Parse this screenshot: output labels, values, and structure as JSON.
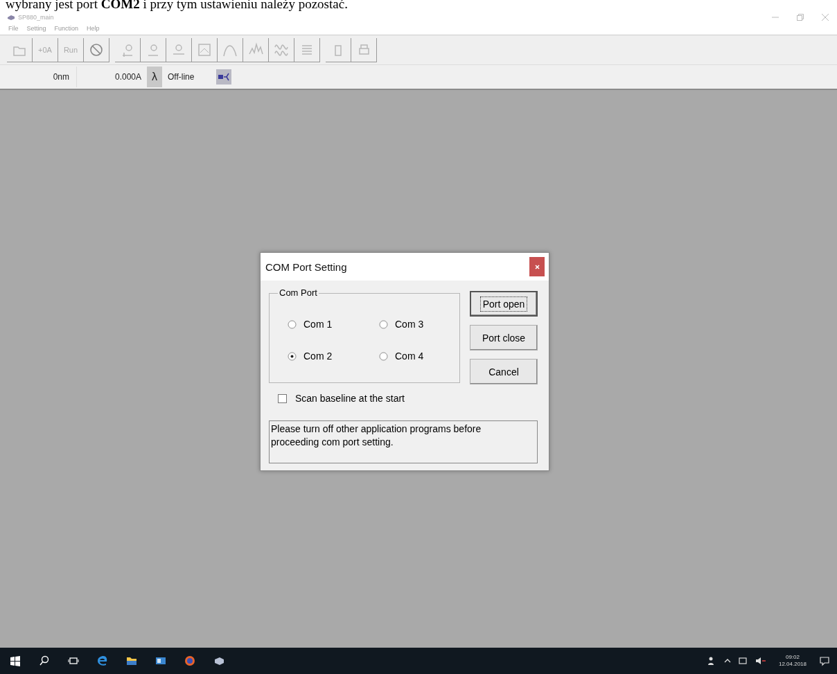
{
  "caption": "wybrany jest port **COM2** i przy tym ustawieniu należy pozostać.",
  "window": {
    "title": "SP880_main"
  },
  "menu": [
    "File",
    "Setting",
    "Function",
    "Help"
  ],
  "toolbar": [
    {
      "kind": "icon"
    },
    {
      "kind": "text",
      "label": "+0A"
    },
    {
      "kind": "text",
      "label": "Run"
    },
    {
      "kind": "icon"
    },
    {
      "kind": "gap"
    },
    {
      "kind": "icon"
    },
    {
      "kind": "icon"
    },
    {
      "kind": "icon"
    },
    {
      "kind": "icon"
    },
    {
      "kind": "icon"
    },
    {
      "kind": "icon"
    },
    {
      "kind": "icon"
    },
    {
      "kind": "icon"
    },
    {
      "kind": "gap"
    },
    {
      "kind": "icon"
    },
    {
      "kind": "icon"
    }
  ],
  "status_bar": {
    "wavelength": "0nm",
    "absorbance": "0.000A",
    "lambda": "λ",
    "connection": "Off-line"
  },
  "dialog": {
    "title": "COM Port Setting",
    "group_title": "Com Port",
    "ports": [
      {
        "label": "Com 1",
        "selected": false
      },
      {
        "label": "Com 3",
        "selected": false
      },
      {
        "label": "Com 2",
        "selected": true
      },
      {
        "label": "Com 4",
        "selected": false
      }
    ],
    "buttons": [
      {
        "label": "Port open",
        "default": true
      },
      {
        "label": "Port close",
        "default": false
      },
      {
        "label": "Cancel",
        "default": false
      }
    ],
    "checkbox": {
      "label": "Scan baseline at the start",
      "checked": false
    },
    "message": "Please turn off other application programs before proceeding com port setting."
  },
  "taskbar": {
    "time": "09:02",
    "date": "12.04.2018"
  }
}
